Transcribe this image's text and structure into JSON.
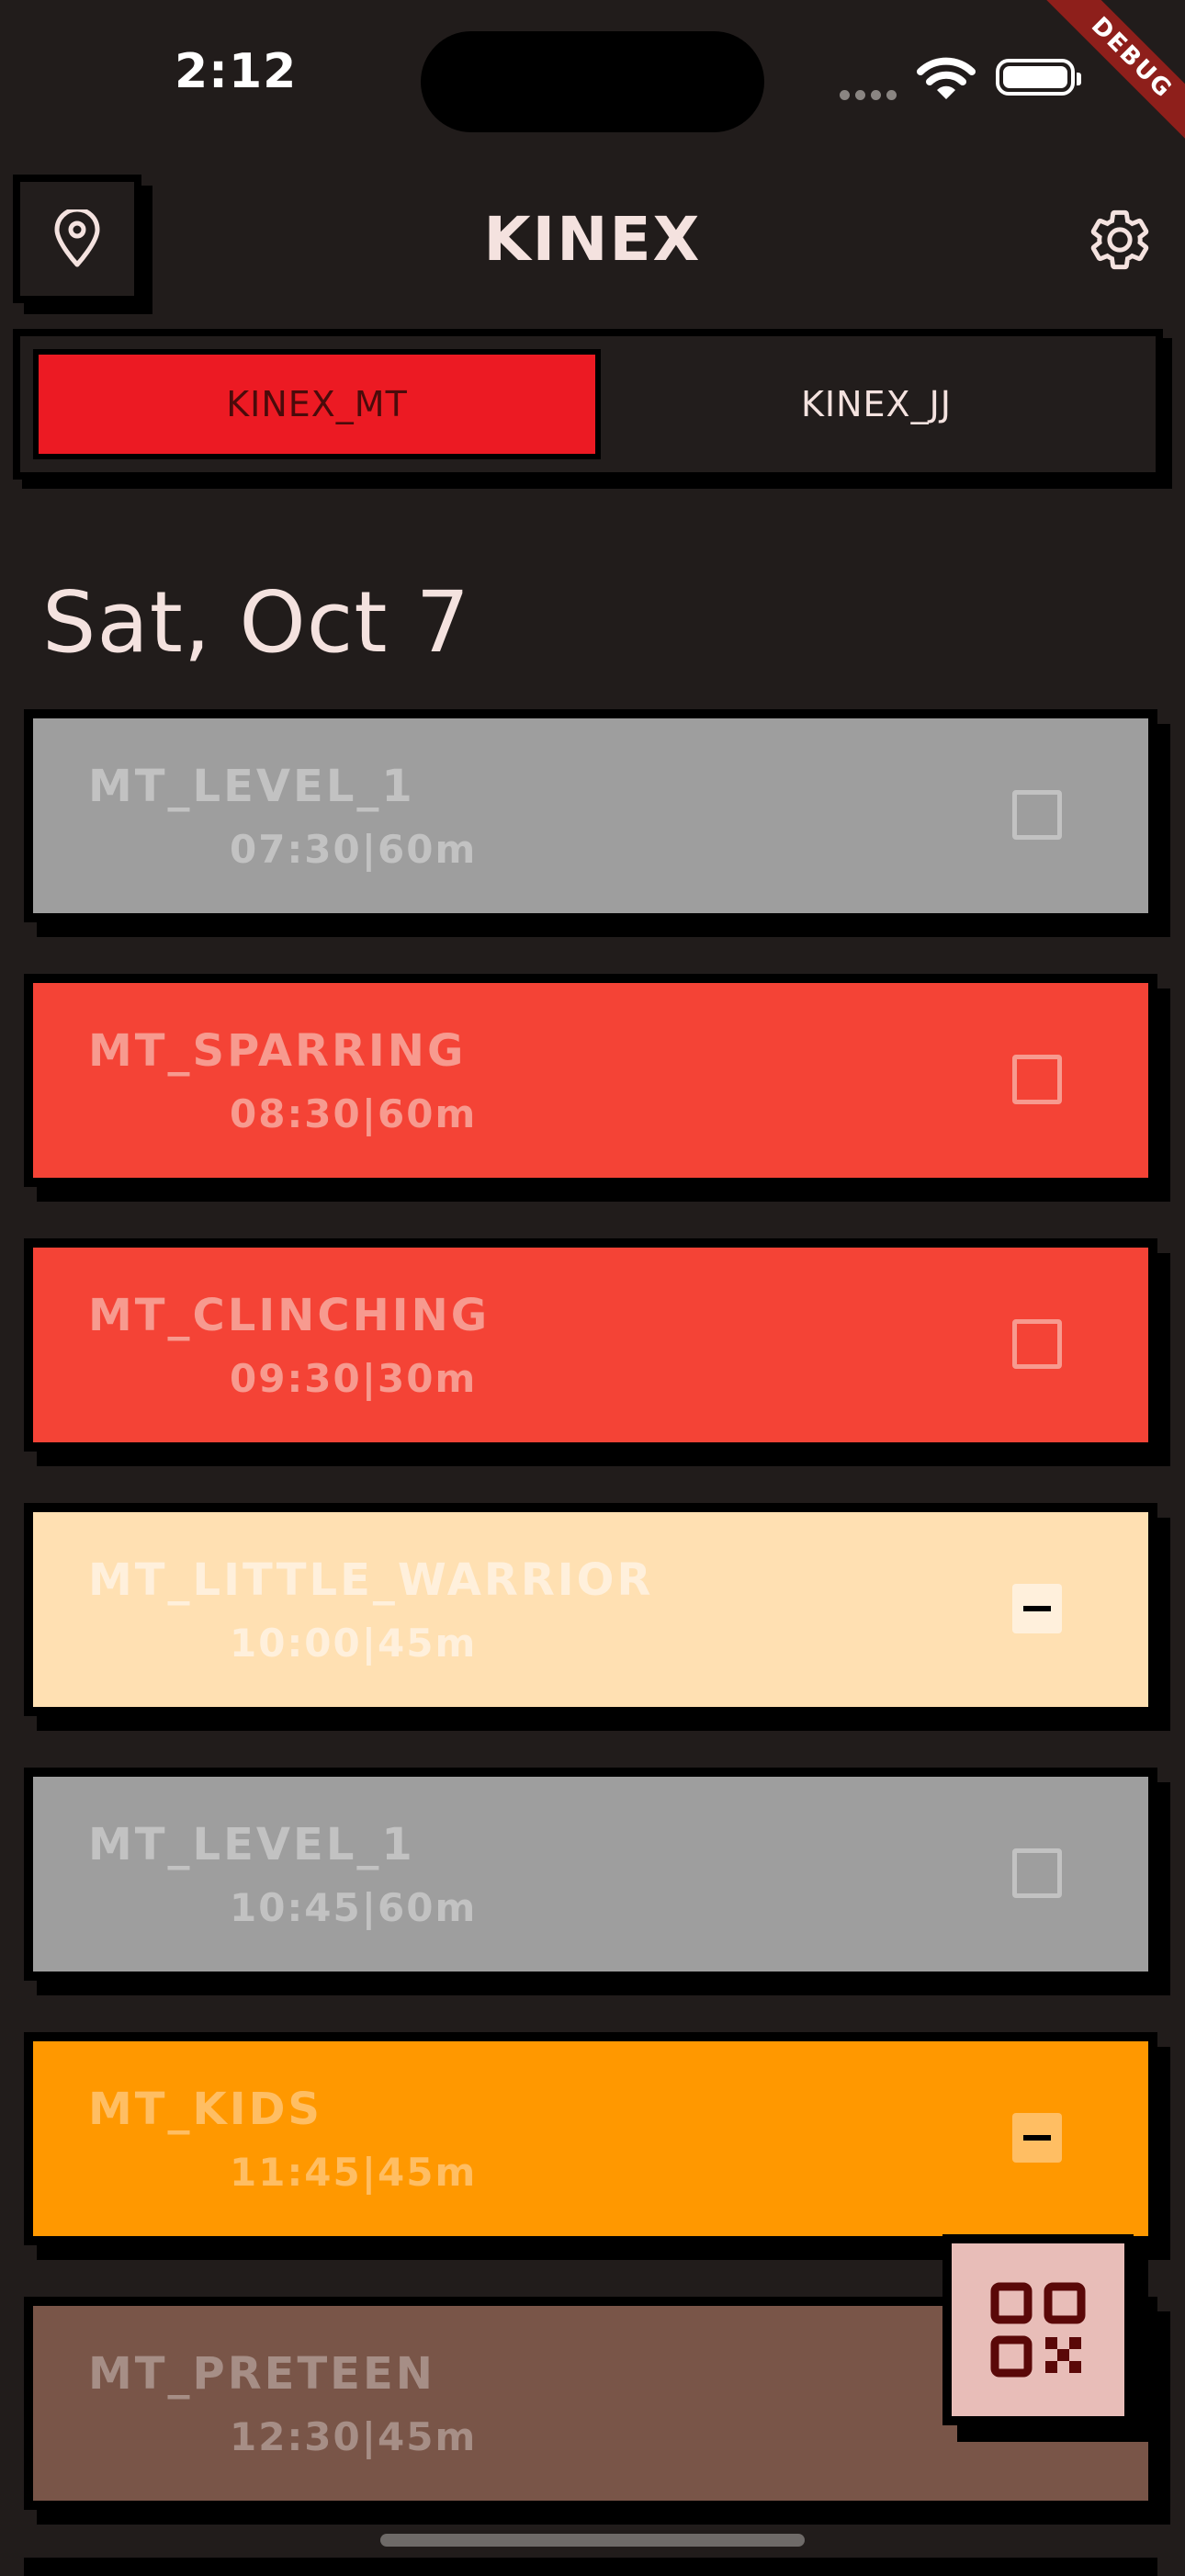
{
  "status_bar": {
    "time": "2:12",
    "debug_banner": "DEBUG"
  },
  "header": {
    "location_icon": "location-pin-icon",
    "title": "KINEX",
    "settings_icon": "gear-icon"
  },
  "tabs": [
    {
      "label": "KINEX_MT",
      "active": true
    },
    {
      "label": "KINEX_JJ",
      "active": false
    }
  ],
  "date_heading": "Sat, Oct 7",
  "classes": [
    {
      "name": "MT_LEVEL_1",
      "info": "07:30|60m",
      "color": "#9e9e9e",
      "text_color": "#c2c2c2",
      "checkbox": "unchecked"
    },
    {
      "name": "MT_SPARRING",
      "info": "08:30|60m",
      "color": "#f44336",
      "text_color": "#f79a8f",
      "checkbox": "unchecked"
    },
    {
      "name": "MT_CLINCHING",
      "info": "09:30|30m",
      "color": "#f44336",
      "text_color": "#f79a8f",
      "checkbox": "unchecked"
    },
    {
      "name": "MT_LITTLE_WARRIOR",
      "info": "10:00|45m",
      "color": "#ffe0b2",
      "text_color": "#fff0dc",
      "checkbox": "indeterminate"
    },
    {
      "name": "MT_LEVEL_1",
      "info": "10:45|60m",
      "color": "#9e9e9e",
      "text_color": "#c2c2c2",
      "checkbox": "unchecked"
    },
    {
      "name": "MT_KIDS",
      "info": "11:45|45m",
      "color": "#ff9800",
      "text_color": "#ffbe63",
      "checkbox": "indeterminate"
    },
    {
      "name": "MT_PRETEEN",
      "info": "12:30|45m",
      "color": "#795548",
      "text_color": "#a68e86",
      "checkbox": "unchecked"
    }
  ],
  "fab": {
    "icon": "qr-code-icon"
  }
}
